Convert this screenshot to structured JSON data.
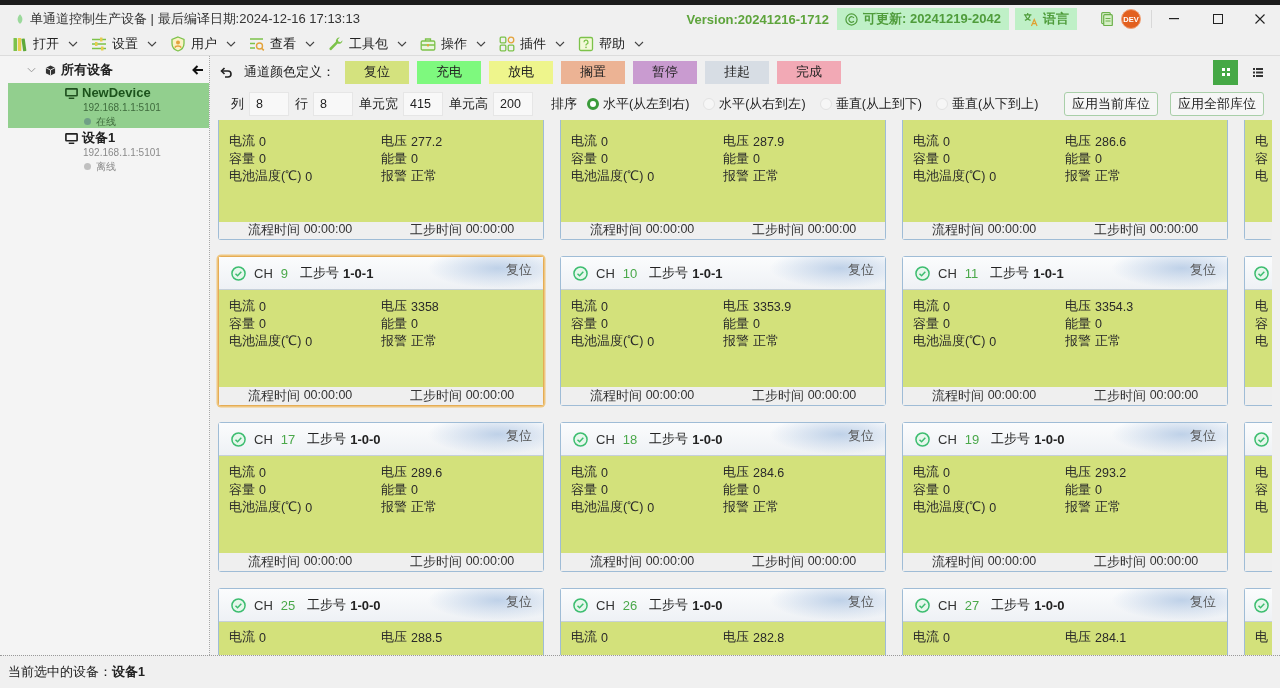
{
  "window": {
    "title": "单通道控制生产设备 | 最后编译日期:2024-12-16 17:13:13",
    "version": "Version:20241216-1712",
    "update": "可更新: 20241219-2042",
    "language": "语言",
    "avatar": "DEV"
  },
  "menu": [
    {
      "label": "打开",
      "kind": "books"
    },
    {
      "label": "设置",
      "kind": "sliders"
    },
    {
      "label": "用户",
      "kind": "user"
    },
    {
      "label": "查看",
      "kind": "view"
    },
    {
      "label": "工具包",
      "kind": "wrench"
    },
    {
      "label": "操作",
      "kind": "toolbox"
    },
    {
      "label": "插件",
      "kind": "plugins"
    },
    {
      "label": "帮助",
      "kind": "help"
    }
  ],
  "sidebar": {
    "root": {
      "label": "所有设备",
      "expanded": true,
      "children": [
        {
          "name": "NewDevice",
          "address": "192.168.1.1:5101",
          "status": "在线",
          "selected": true
        },
        {
          "name": "设备1",
          "address": "192.168.1.1:5101",
          "status": "离线",
          "selected": false
        }
      ]
    }
  },
  "legend": {
    "label": "通道颜色定义：",
    "items": [
      {
        "label": "复位",
        "color": "#d4e27e"
      },
      {
        "label": "充电",
        "color": "#7ef97e"
      },
      {
        "label": "放电",
        "color": "#eef58c"
      },
      {
        "label": "搁置",
        "color": "#ecb394"
      },
      {
        "label": "暂停",
        "color": "#c99bd0"
      },
      {
        "label": "挂起",
        "color": "#d7dde4"
      },
      {
        "label": "完成",
        "color": "#f2a9b5"
      }
    ]
  },
  "view_modes": [
    {
      "kind": "grid",
      "selected": true
    },
    {
      "kind": "list",
      "selected": false
    }
  ],
  "layout_settings": {
    "fields": [
      {
        "label": "列",
        "value": "8"
      },
      {
        "label": "行",
        "value": "8"
      },
      {
        "label": "单元宽",
        "value": "415"
      },
      {
        "label": "单元高",
        "value": "200"
      }
    ],
    "sort_label": "排序",
    "sort_options": [
      {
        "label": "水平(从左到右)",
        "selected": true
      },
      {
        "label": "水平(从右到左)",
        "selected": false
      },
      {
        "label": "垂直(从上到下)",
        "selected": false
      },
      {
        "label": "垂直(从下到上)",
        "selected": false
      }
    ],
    "buttons": [
      "应用当前库位",
      "应用全部库位"
    ]
  },
  "card_rows": [
    {
      "kind": "top_cut",
      "cards": [
        {
          "color": "#d3e17b",
          "selected": false,
          "readings": [
            {
              "label": "电流",
              "value": "0"
            },
            {
              "label": "电压",
              "value": "277.2"
            },
            {
              "label": "容量",
              "value": "0"
            },
            {
              "label": "能量",
              "value": "0"
            },
            {
              "label": "电池温度(℃)",
              "value": "0"
            },
            {
              "label": "报警",
              "value": "正常"
            }
          ],
          "times": [
            {
              "label": "流程时间",
              "value": "00:00:00"
            },
            {
              "label": "工步时间",
              "value": "00:00:00"
            }
          ]
        },
        {
          "color": "#d3e17b",
          "selected": false,
          "readings": [
            {
              "label": "电流",
              "value": "0"
            },
            {
              "label": "电压",
              "value": "287.9"
            },
            {
              "label": "容量",
              "value": "0"
            },
            {
              "label": "能量",
              "value": "0"
            },
            {
              "label": "电池温度(℃)",
              "value": "0"
            },
            {
              "label": "报警",
              "value": "正常"
            }
          ],
          "times": [
            {
              "label": "流程时间",
              "value": "00:00:00"
            },
            {
              "label": "工步时间",
              "value": "00:00:00"
            }
          ]
        },
        {
          "color": "#d3e17b",
          "selected": false,
          "readings": [
            {
              "label": "电流",
              "value": "0"
            },
            {
              "label": "电压",
              "value": "286.6"
            },
            {
              "label": "容量",
              "value": "0"
            },
            {
              "label": "能量",
              "value": "0"
            },
            {
              "label": "电池温度(℃)",
              "value": "0"
            },
            {
              "label": "报警",
              "value": "正常"
            }
          ],
          "times": [
            {
              "label": "流程时间",
              "value": "00:00:00"
            },
            {
              "label": "工步时间",
              "value": "00:00:00"
            }
          ]
        }
      ],
      "edge": {
        "color": "#d3e17b",
        "letters": [
          "电",
          "容",
          "电"
        ]
      }
    },
    {
      "kind": "full",
      "cards": [
        {
          "ch_label": "CH",
          "ch": "9",
          "step_label": "工步号",
          "step": "1-0-1",
          "state": "复位",
          "color": "#d3e17b",
          "selected": true,
          "readings": [
            {
              "label": "电流",
              "value": "0"
            },
            {
              "label": "电压",
              "value": "3358"
            },
            {
              "label": "容量",
              "value": "0"
            },
            {
              "label": "能量",
              "value": "0"
            },
            {
              "label": "电池温度(℃)",
              "value": "0"
            },
            {
              "label": "报警",
              "value": "正常"
            }
          ],
          "times": [
            {
              "label": "流程时间",
              "value": "00:00:00"
            },
            {
              "label": "工步时间",
              "value": "00:00:00"
            }
          ]
        },
        {
          "ch_label": "CH",
          "ch": "10",
          "step_label": "工步号",
          "step": "1-0-1",
          "state": "复位",
          "color": "#d3e17b",
          "selected": false,
          "readings": [
            {
              "label": "电流",
              "value": "0"
            },
            {
              "label": "电压",
              "value": "3353.9"
            },
            {
              "label": "容量",
              "value": "0"
            },
            {
              "label": "能量",
              "value": "0"
            },
            {
              "label": "电池温度(℃)",
              "value": "0"
            },
            {
              "label": "报警",
              "value": "正常"
            }
          ],
          "times": [
            {
              "label": "流程时间",
              "value": "00:00:00"
            },
            {
              "label": "工步时间",
              "value": "00:00:00"
            }
          ]
        },
        {
          "ch_label": "CH",
          "ch": "11",
          "step_label": "工步号",
          "step": "1-0-1",
          "state": "复位",
          "color": "#d3e17b",
          "selected": false,
          "readings": [
            {
              "label": "电流",
              "value": "0"
            },
            {
              "label": "电压",
              "value": "3354.3"
            },
            {
              "label": "容量",
              "value": "0"
            },
            {
              "label": "能量",
              "value": "0"
            },
            {
              "label": "电池温度(℃)",
              "value": "0"
            },
            {
              "label": "报警",
              "value": "正常"
            }
          ],
          "times": [
            {
              "label": "流程时间",
              "value": "00:00:00"
            },
            {
              "label": "工步时间",
              "value": "00:00:00"
            }
          ]
        }
      ],
      "edge": {
        "color": "#d3e17b",
        "letters": [
          "电",
          "容",
          "电"
        ]
      }
    },
    {
      "kind": "full",
      "cards": [
        {
          "ch_label": "CH",
          "ch": "17",
          "step_label": "工步号",
          "step": "1-0-0",
          "state": "复位",
          "color": "#d3e17b",
          "selected": false,
          "readings": [
            {
              "label": "电流",
              "value": "0"
            },
            {
              "label": "电压",
              "value": "289.6"
            },
            {
              "label": "容量",
              "value": "0"
            },
            {
              "label": "能量",
              "value": "0"
            },
            {
              "label": "电池温度(℃)",
              "value": "0"
            },
            {
              "label": "报警",
              "value": "正常"
            }
          ],
          "times": [
            {
              "label": "流程时间",
              "value": "00:00:00"
            },
            {
              "label": "工步时间",
              "value": "00:00:00"
            }
          ]
        },
        {
          "ch_label": "CH",
          "ch": "18",
          "step_label": "工步号",
          "step": "1-0-0",
          "state": "复位",
          "color": "#d3e17b",
          "selected": false,
          "readings": [
            {
              "label": "电流",
              "value": "0"
            },
            {
              "label": "电压",
              "value": "284.6"
            },
            {
              "label": "容量",
              "value": "0"
            },
            {
              "label": "能量",
              "value": "0"
            },
            {
              "label": "电池温度(℃)",
              "value": "0"
            },
            {
              "label": "报警",
              "value": "正常"
            }
          ],
          "times": [
            {
              "label": "流程时间",
              "value": "00:00:00"
            },
            {
              "label": "工步时间",
              "value": "00:00:00"
            }
          ]
        },
        {
          "ch_label": "CH",
          "ch": "19",
          "step_label": "工步号",
          "step": "1-0-0",
          "state": "复位",
          "color": "#d3e17b",
          "selected": false,
          "readings": [
            {
              "label": "电流",
              "value": "0"
            },
            {
              "label": "电压",
              "value": "293.2"
            },
            {
              "label": "容量",
              "value": "0"
            },
            {
              "label": "能量",
              "value": "0"
            },
            {
              "label": "电池温度(℃)",
              "value": "0"
            },
            {
              "label": "报警",
              "value": "正常"
            }
          ],
          "times": [
            {
              "label": "流程时间",
              "value": "00:00:00"
            },
            {
              "label": "工步时间",
              "value": "00:00:00"
            }
          ]
        }
      ],
      "edge": {
        "color": "#d3e17b",
        "letters": [
          "电",
          "容",
          "电"
        ]
      }
    },
    {
      "kind": "bottom_cut",
      "cards": [
        {
          "ch_label": "CH",
          "ch": "25",
          "step_label": "工步号",
          "step": "1-0-0",
          "state": "复位",
          "color": "#d3e17b",
          "selected": false,
          "readings": [
            {
              "label": "电流",
              "value": "0"
            },
            {
              "label": "电压",
              "value": "288.5"
            }
          ]
        },
        {
          "ch_label": "CH",
          "ch": "26",
          "step_label": "工步号",
          "step": "1-0-0",
          "state": "复位",
          "color": "#d3e17b",
          "selected": false,
          "readings": [
            {
              "label": "电流",
              "value": "0"
            },
            {
              "label": "电压",
              "value": "282.8"
            }
          ]
        },
        {
          "ch_label": "CH",
          "ch": "27",
          "step_label": "工步号",
          "step": "1-0-0",
          "state": "复位",
          "color": "#d3e17b",
          "selected": false,
          "readings": [
            {
              "label": "电流",
              "value": "0"
            },
            {
              "label": "电压",
              "value": "284.1"
            }
          ]
        }
      ],
      "edge": {
        "color": "#d3e17b",
        "letters": [
          "电"
        ]
      }
    }
  ],
  "status_bar": {
    "label": "当前选中的设备：",
    "value": "设备1"
  }
}
